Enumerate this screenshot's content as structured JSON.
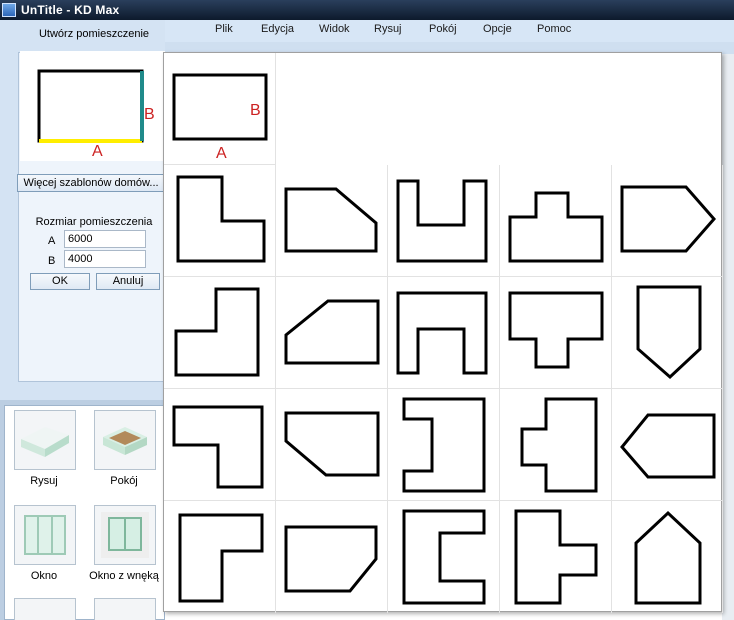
{
  "window": {
    "title": "UnTitle - KD Max"
  },
  "menu": [
    "Plik",
    "Edycja",
    "Widok",
    "Rysuj",
    "Pokój",
    "Opcje",
    "Pomoc"
  ],
  "create_panel": {
    "title": "Utwórz pomieszczenie",
    "preview_label_a": "A",
    "preview_label_b": "B",
    "more_templates_button": "Więcej szablonów domów...",
    "size_title": "Rozmiar pomieszczenia",
    "field_a_label": "A",
    "field_a_value": "6000",
    "field_b_label": "B",
    "field_b_value": "4000",
    "ok_button": "OK",
    "cancel_button": "Anuluj"
  },
  "tools": [
    {
      "label": "Rysuj",
      "icon": "walls-icon"
    },
    {
      "label": "Pokój",
      "icon": "room-icon"
    },
    {
      "label": "Okno",
      "icon": "window-icon"
    },
    {
      "label": "Okno z wnęką",
      "icon": "window-recess-icon"
    }
  ],
  "template_popup": {
    "label_a": "A",
    "label_b": "B",
    "shapes": [
      "rectangle",
      "l-shape",
      "cut-corner",
      "u-shape",
      "t-shape",
      "arrow-right",
      "l-shape-flipped",
      "cut-corner-left",
      "n-shape",
      "t-shape-down",
      "pentagon-down",
      "l-shape-down",
      "cut-corner-bottom",
      "bracket-left",
      "cross-left",
      "arrow-left",
      "l-shape-up",
      "trapezoid",
      "c-shape",
      "cross-right",
      "pentagon-up"
    ]
  },
  "colors": {
    "title_bar": "#1b2b43",
    "label_red": "#cc2222",
    "edge_yellow": "#ffee00",
    "edge_teal": "#1f8a8a"
  }
}
